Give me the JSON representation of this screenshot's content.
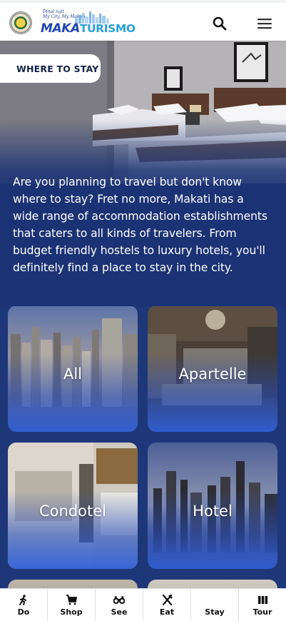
{
  "header": {
    "seal_icon": "makati-seal-icon",
    "brand_tagline_1": "Dinal ngit",
    "brand_tagline_2": "My City, My Makati",
    "brand_mak": "MAK",
    "brand_ati": "A",
    "brand_tur": "TURISMO",
    "search_icon": "search-icon",
    "menu_icon": "hamburger-menu-icon"
  },
  "hero": {
    "tab_label": "WHERE TO STAY",
    "intro": "Are you planning to travel but don't know where to stay? Fret no more, Makati has a wide range of accommodation establishments that caters to all kinds of travelers. From budget friendly hostels to luxury hotels, you'll definitely find a place to stay in the city."
  },
  "categories": [
    {
      "label": "All"
    },
    {
      "label": "Apartelle"
    },
    {
      "label": "Condotel"
    },
    {
      "label": "Hotel"
    }
  ],
  "bottom_nav": [
    {
      "label": "Do",
      "icon": "walking-person-icon"
    },
    {
      "label": "Shop",
      "icon": "shopping-cart-icon"
    },
    {
      "label": "See",
      "icon": "binoculars-icon"
    },
    {
      "label": "Eat",
      "icon": "fork-knife-icon"
    },
    {
      "label": "Stay",
      "icon": "bed-icon"
    },
    {
      "label": "Tour",
      "icon": "map-icon"
    }
  ],
  "colors": {
    "page_blue": "#1e3778",
    "card_blue": "#2f5fd6",
    "text_dark": "#15224a"
  }
}
